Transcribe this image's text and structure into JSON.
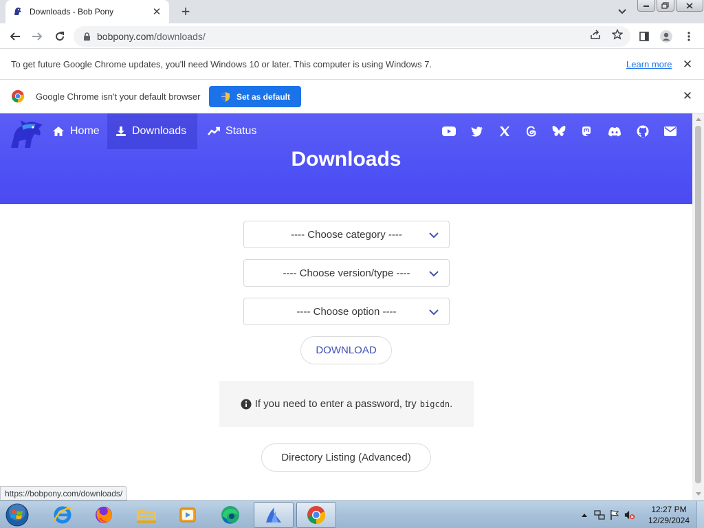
{
  "browser": {
    "tab": {
      "title": "Downloads - Bob Pony",
      "favicon": "bobpony-favicon",
      "close_icon": "close-icon"
    },
    "new_tab_icon": "plus-icon",
    "address": {
      "domain": "bobpony.com",
      "path": "/downloads/"
    },
    "toolbar_icons": [
      "back-arrow-icon",
      "forward-arrow-icon",
      "reload-icon",
      "share-icon",
      "star-icon",
      "side-panel-icon",
      "profile-icon",
      "menu-icon"
    ]
  },
  "infobars": {
    "update": {
      "text": "To get future Google Chrome updates, you'll need Windows 10 or later. This computer is using Windows 7.",
      "link": "Learn more",
      "close": "✕"
    },
    "default_browser": {
      "text": "Google Chrome isn't your default browser",
      "button": "Set as default",
      "close": "✕"
    }
  },
  "site": {
    "nav": [
      {
        "label": "Home",
        "icon": "home-icon",
        "active": false
      },
      {
        "label": "Downloads",
        "icon": "download-icon",
        "active": true
      },
      {
        "label": "Status",
        "icon": "trend-icon",
        "active": false
      }
    ],
    "social_icons": [
      "youtube-icon",
      "twitter-icon",
      "x-icon",
      "threads-icon",
      "bluesky-icon",
      "mastodon-icon",
      "discord-icon",
      "github-icon",
      "email-icon"
    ],
    "hero_title": "Downloads",
    "selects": {
      "category": "---- Choose category ----",
      "version": "---- Choose version/type ----",
      "option": "---- Choose option ----"
    },
    "download_button": "DOWNLOAD",
    "notice": {
      "text": "If you need to enter a password, try",
      "code": "bigcdn",
      "suffix": "."
    },
    "directory_button": "Directory Listing (Advanced)",
    "accent_color": "#4f52f4"
  },
  "status_bar": {
    "url": "https://bobpony.com/downloads/"
  },
  "taskbar": {
    "apps": [
      "internet-explorer",
      "firefox",
      "file-explorer",
      "media-player",
      "edge",
      "app-blue-bird",
      "chrome"
    ],
    "clock": {
      "time": "12:27 PM",
      "date": "12/29/2024"
    }
  }
}
